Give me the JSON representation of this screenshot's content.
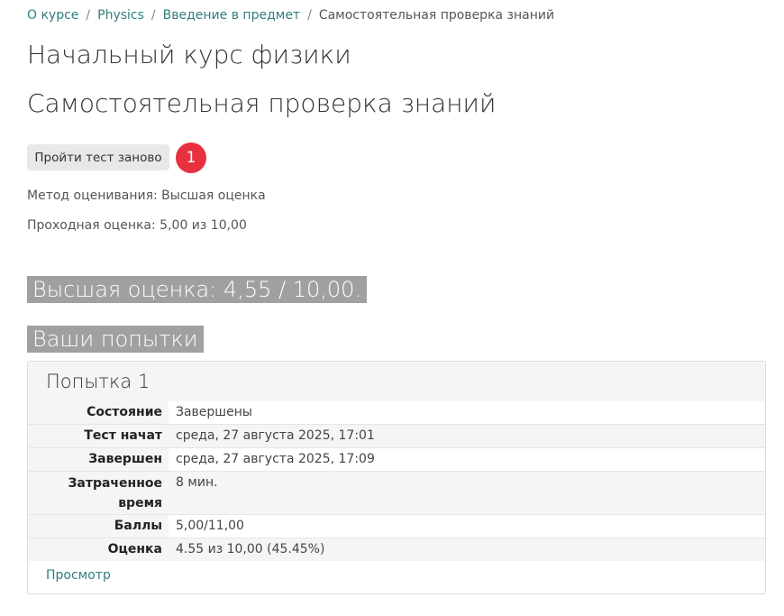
{
  "breadcrumb": {
    "items": [
      "О курсе",
      "Physics",
      "Введение в предмет"
    ],
    "current": "Самостоятельная проверка знаний",
    "separator": "/"
  },
  "course_title": "Начальный курс физики",
  "page_title": "Самостоятельная проверка знаний",
  "retake_button": "Пройти тест заново",
  "notification_badge": "1",
  "grading_method": "Метод оценивания: Высшая оценка",
  "passing_grade": "Проходная оценка: 5,00 из 10,00",
  "best_grade": "Высшая оценка: 4,55 / 10,00.",
  "attempts_heading": "Ваши попытки",
  "attempt": {
    "title": "Попытка 1",
    "rows": [
      {
        "label": "Состояние",
        "value": "Завершены"
      },
      {
        "label": "Тест начат",
        "value": "среда, 27 августа 2025, 17:01"
      },
      {
        "label": "Завершен",
        "value": "среда, 27 августа 2025, 17:09"
      },
      {
        "label": "Затраченное время",
        "value": "8 мин."
      },
      {
        "label": "Баллы",
        "value": "5,00/11,00"
      },
      {
        "label": "Оценка",
        "value": "4.55 из 10,00 (45.45%)"
      }
    ],
    "review_link": "Просмотр"
  },
  "colors": {
    "link": "#2f7e7c",
    "badge": "#e8303f",
    "highlight_bg": "#a0a0a0",
    "button_bg": "#e8e8e8"
  }
}
